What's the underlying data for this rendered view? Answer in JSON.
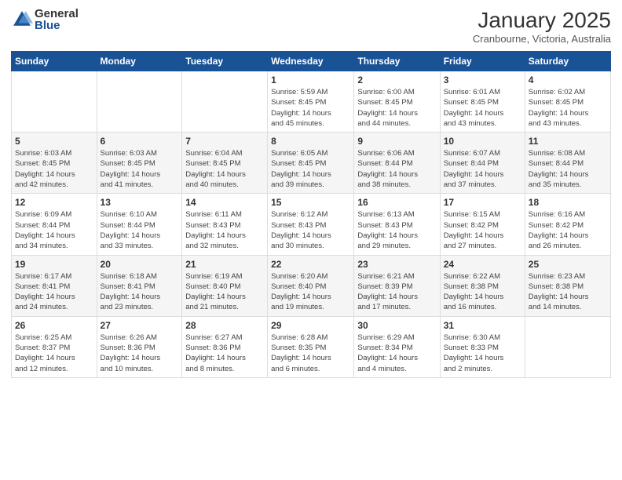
{
  "logo": {
    "general": "General",
    "blue": "Blue"
  },
  "title": "January 2025",
  "location": "Cranbourne, Victoria, Australia",
  "weekdays": [
    "Sunday",
    "Monday",
    "Tuesday",
    "Wednesday",
    "Thursday",
    "Friday",
    "Saturday"
  ],
  "weeks": [
    [
      {
        "day": "",
        "info": ""
      },
      {
        "day": "",
        "info": ""
      },
      {
        "day": "",
        "info": ""
      },
      {
        "day": "1",
        "info": "Sunrise: 5:59 AM\nSunset: 8:45 PM\nDaylight: 14 hours\nand 45 minutes."
      },
      {
        "day": "2",
        "info": "Sunrise: 6:00 AM\nSunset: 8:45 PM\nDaylight: 14 hours\nand 44 minutes."
      },
      {
        "day": "3",
        "info": "Sunrise: 6:01 AM\nSunset: 8:45 PM\nDaylight: 14 hours\nand 43 minutes."
      },
      {
        "day": "4",
        "info": "Sunrise: 6:02 AM\nSunset: 8:45 PM\nDaylight: 14 hours\nand 43 minutes."
      }
    ],
    [
      {
        "day": "5",
        "info": "Sunrise: 6:03 AM\nSunset: 8:45 PM\nDaylight: 14 hours\nand 42 minutes."
      },
      {
        "day": "6",
        "info": "Sunrise: 6:03 AM\nSunset: 8:45 PM\nDaylight: 14 hours\nand 41 minutes."
      },
      {
        "day": "7",
        "info": "Sunrise: 6:04 AM\nSunset: 8:45 PM\nDaylight: 14 hours\nand 40 minutes."
      },
      {
        "day": "8",
        "info": "Sunrise: 6:05 AM\nSunset: 8:45 PM\nDaylight: 14 hours\nand 39 minutes."
      },
      {
        "day": "9",
        "info": "Sunrise: 6:06 AM\nSunset: 8:44 PM\nDaylight: 14 hours\nand 38 minutes."
      },
      {
        "day": "10",
        "info": "Sunrise: 6:07 AM\nSunset: 8:44 PM\nDaylight: 14 hours\nand 37 minutes."
      },
      {
        "day": "11",
        "info": "Sunrise: 6:08 AM\nSunset: 8:44 PM\nDaylight: 14 hours\nand 35 minutes."
      }
    ],
    [
      {
        "day": "12",
        "info": "Sunrise: 6:09 AM\nSunset: 8:44 PM\nDaylight: 14 hours\nand 34 minutes."
      },
      {
        "day": "13",
        "info": "Sunrise: 6:10 AM\nSunset: 8:44 PM\nDaylight: 14 hours\nand 33 minutes."
      },
      {
        "day": "14",
        "info": "Sunrise: 6:11 AM\nSunset: 8:43 PM\nDaylight: 14 hours\nand 32 minutes."
      },
      {
        "day": "15",
        "info": "Sunrise: 6:12 AM\nSunset: 8:43 PM\nDaylight: 14 hours\nand 30 minutes."
      },
      {
        "day": "16",
        "info": "Sunrise: 6:13 AM\nSunset: 8:43 PM\nDaylight: 14 hours\nand 29 minutes."
      },
      {
        "day": "17",
        "info": "Sunrise: 6:15 AM\nSunset: 8:42 PM\nDaylight: 14 hours\nand 27 minutes."
      },
      {
        "day": "18",
        "info": "Sunrise: 6:16 AM\nSunset: 8:42 PM\nDaylight: 14 hours\nand 26 minutes."
      }
    ],
    [
      {
        "day": "19",
        "info": "Sunrise: 6:17 AM\nSunset: 8:41 PM\nDaylight: 14 hours\nand 24 minutes."
      },
      {
        "day": "20",
        "info": "Sunrise: 6:18 AM\nSunset: 8:41 PM\nDaylight: 14 hours\nand 23 minutes."
      },
      {
        "day": "21",
        "info": "Sunrise: 6:19 AM\nSunset: 8:40 PM\nDaylight: 14 hours\nand 21 minutes."
      },
      {
        "day": "22",
        "info": "Sunrise: 6:20 AM\nSunset: 8:40 PM\nDaylight: 14 hours\nand 19 minutes."
      },
      {
        "day": "23",
        "info": "Sunrise: 6:21 AM\nSunset: 8:39 PM\nDaylight: 14 hours\nand 17 minutes."
      },
      {
        "day": "24",
        "info": "Sunrise: 6:22 AM\nSunset: 8:38 PM\nDaylight: 14 hours\nand 16 minutes."
      },
      {
        "day": "25",
        "info": "Sunrise: 6:23 AM\nSunset: 8:38 PM\nDaylight: 14 hours\nand 14 minutes."
      }
    ],
    [
      {
        "day": "26",
        "info": "Sunrise: 6:25 AM\nSunset: 8:37 PM\nDaylight: 14 hours\nand 12 minutes."
      },
      {
        "day": "27",
        "info": "Sunrise: 6:26 AM\nSunset: 8:36 PM\nDaylight: 14 hours\nand 10 minutes."
      },
      {
        "day": "28",
        "info": "Sunrise: 6:27 AM\nSunset: 8:36 PM\nDaylight: 14 hours\nand 8 minutes."
      },
      {
        "day": "29",
        "info": "Sunrise: 6:28 AM\nSunset: 8:35 PM\nDaylight: 14 hours\nand 6 minutes."
      },
      {
        "day": "30",
        "info": "Sunrise: 6:29 AM\nSunset: 8:34 PM\nDaylight: 14 hours\nand 4 minutes."
      },
      {
        "day": "31",
        "info": "Sunrise: 6:30 AM\nSunset: 8:33 PM\nDaylight: 14 hours\nand 2 minutes."
      },
      {
        "day": "",
        "info": ""
      }
    ]
  ]
}
